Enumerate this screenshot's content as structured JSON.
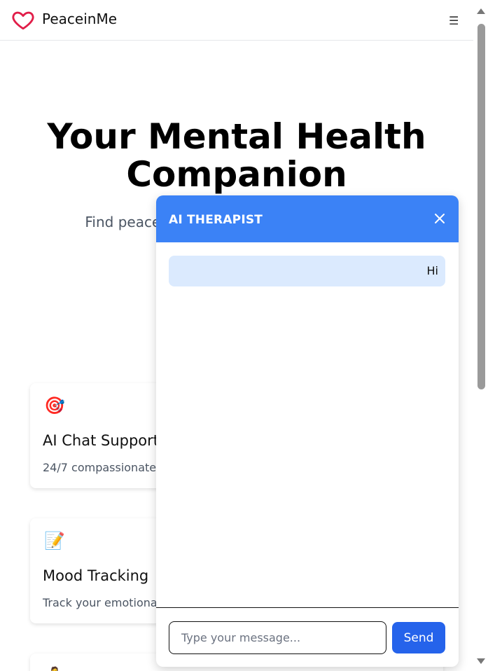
{
  "header": {
    "app_name": "PeaceinMe",
    "menu_glyph": "☰",
    "brand_color": "#e11d48",
    "logo_icon": "heart-outline-icon"
  },
  "hero": {
    "title": "Your Mental Health Companion",
    "subtitle": "Find peace, support, ar al well-being. We're"
  },
  "features": [
    {
      "icon": "🎯",
      "icon_name": "target-icon",
      "title": "AI Chat Support",
      "description": "24/7 compassionate"
    },
    {
      "icon": "📝",
      "icon_name": "memo-icon",
      "title": "Mood Tracking",
      "description": "Track your emotiona"
    },
    {
      "icon": "🧘",
      "icon_name": "meditation-icon",
      "title": "",
      "description": ""
    }
  ],
  "chat": {
    "title": "AI THERAPIST",
    "header_color": "#3b82f6",
    "messages": [
      {
        "sender": "user",
        "text": "Hi"
      }
    ],
    "input_placeholder": "Type your message...",
    "input_value": "",
    "send_label": "Send"
  }
}
